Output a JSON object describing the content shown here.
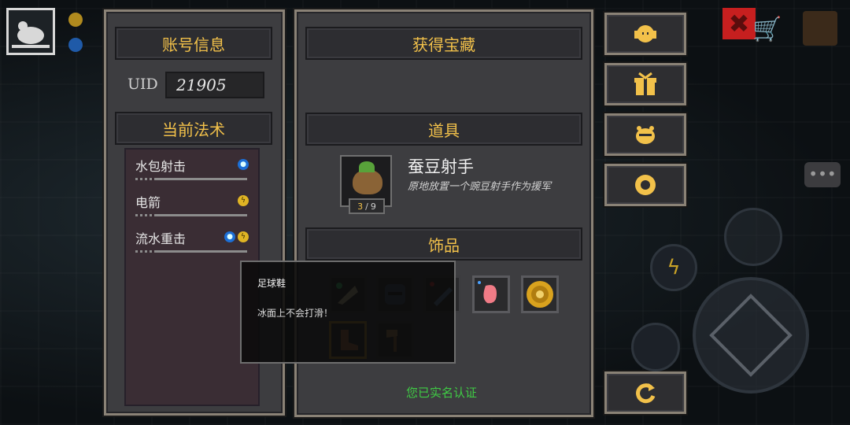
{
  "account": {
    "title": "账号信息",
    "uid_label": "UID",
    "uid_value": "21905"
  },
  "spells": {
    "title": "当前法术",
    "items": [
      {
        "name": "水包射击",
        "elements": [
          "water"
        ]
      },
      {
        "name": "电箭",
        "elements": [
          "lightning"
        ]
      },
      {
        "name": "流水重击",
        "elements": [
          "water",
          "lightning"
        ]
      }
    ]
  },
  "treasure": {
    "title": "获得宝藏",
    "props_title": "道具",
    "prop": {
      "name": "蚕豆射手",
      "description": "原地放置一个豌豆射手作为援军",
      "count": "3",
      "max": "9"
    },
    "ornaments_title": "饰品",
    "verify_text": "您已实名认证"
  },
  "tooltip": {
    "title": "足球鞋",
    "description": "冰面上不会打滑！"
  },
  "side_buttons": [
    "headset-icon",
    "gift-icon",
    "bee-icon",
    "gear-icon",
    "return-icon"
  ],
  "colors": {
    "header_text": "#f2c14a",
    "verify_text": "#3fcc44",
    "frame_border": "#8a8276"
  }
}
